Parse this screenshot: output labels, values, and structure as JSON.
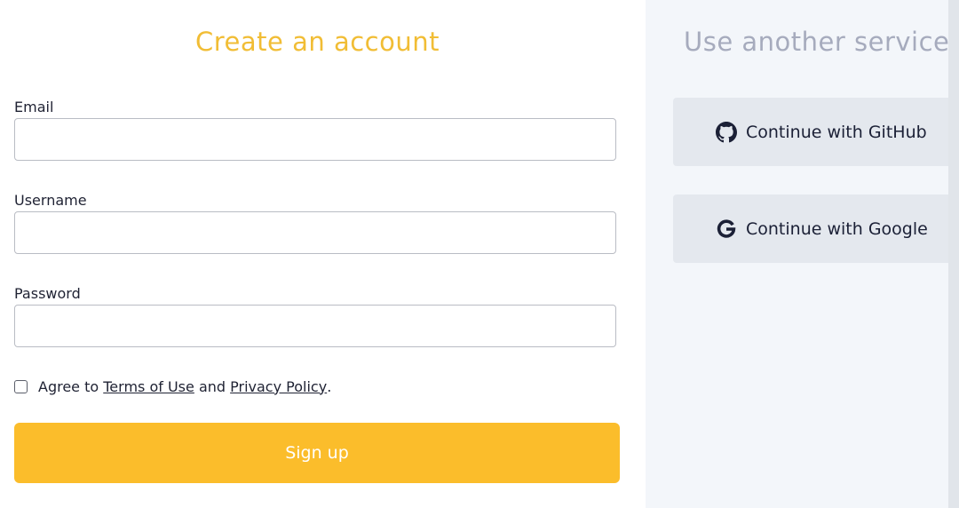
{
  "signup": {
    "title": "Create an account",
    "email_label": "Email",
    "email_value": "",
    "username_label": "Username",
    "username_value": "",
    "password_label": "Password",
    "password_value": "",
    "agree_prefix": "Agree to ",
    "terms_link": "Terms of Use",
    "agree_and": " and ",
    "privacy_link": "Privacy Policy",
    "agree_suffix": ".",
    "agree_checked": false,
    "submit_label": "Sign up"
  },
  "services": {
    "title": "Use another service",
    "github_label": "Continue with GitHub",
    "github_icon": "github-icon",
    "google_label": "Continue with Google",
    "google_icon": "google-icon"
  },
  "colors": {
    "accent": "#fbbd2b",
    "title_accent": "#f1bd35",
    "panel_bg": "#f3f6fa",
    "service_button_bg": "#e4e8ee"
  }
}
